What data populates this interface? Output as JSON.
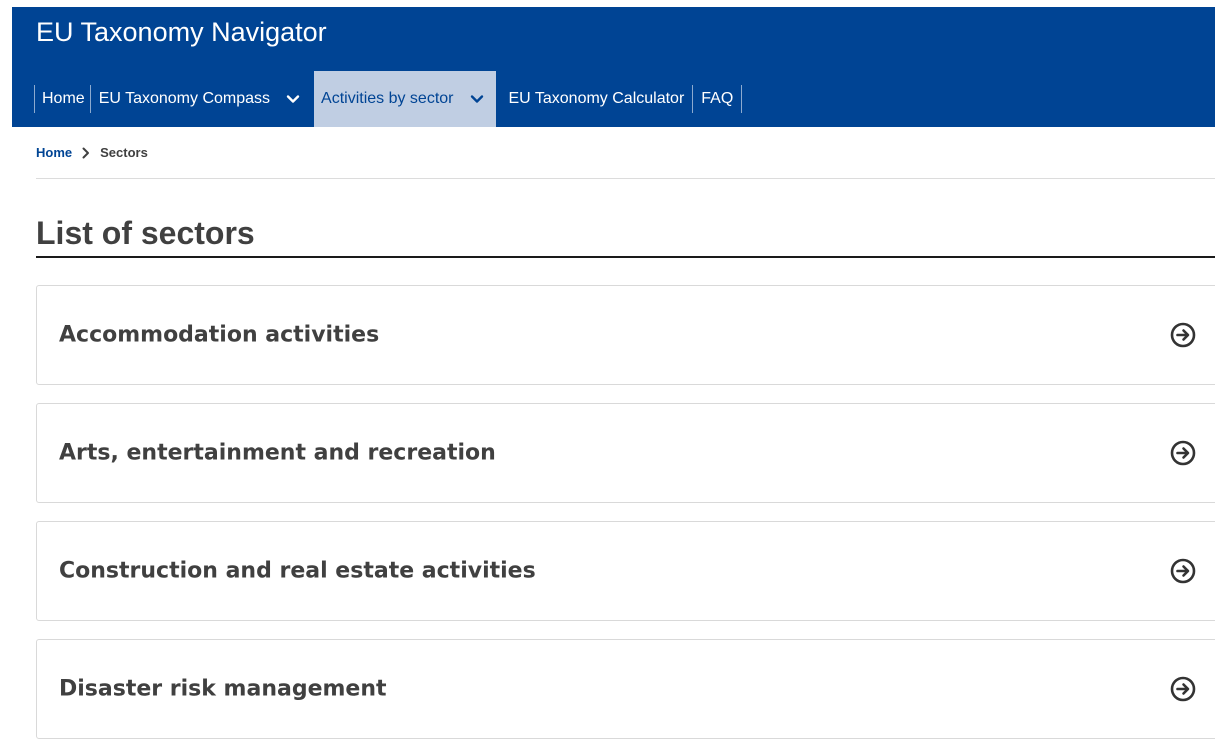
{
  "header": {
    "site_title": "EU Taxonomy Navigator",
    "background_color": "#004494"
  },
  "nav": {
    "items": [
      {
        "label": "Home",
        "has_dropdown": false,
        "active": false
      },
      {
        "label": "EU Taxonomy Compass",
        "has_dropdown": true,
        "active": false,
        "icon": "chevron-down-icon"
      },
      {
        "label": "Activities by sector",
        "has_dropdown": true,
        "active": true,
        "icon": "chevron-down-icon"
      },
      {
        "label": "EU Taxonomy Calculator",
        "has_dropdown": false,
        "active": false
      },
      {
        "label": "FAQ",
        "has_dropdown": false,
        "active": false
      }
    ],
    "active_background": "#c0cee3"
  },
  "breadcrumb": {
    "items": [
      "Home",
      "Sectors"
    ],
    "separator_icon": "chevron-right-icon"
  },
  "main": {
    "title": "List of sectors",
    "sectors": [
      {
        "label": "Accommodation activities",
        "icon": "circle-arrow-right-icon"
      },
      {
        "label": "Arts, entertainment and recreation",
        "icon": "circle-arrow-right-icon"
      },
      {
        "label": "Construction and real estate activities",
        "icon": "circle-arrow-right-icon"
      },
      {
        "label": "Disaster risk management",
        "icon": "circle-arrow-right-icon"
      }
    ]
  }
}
